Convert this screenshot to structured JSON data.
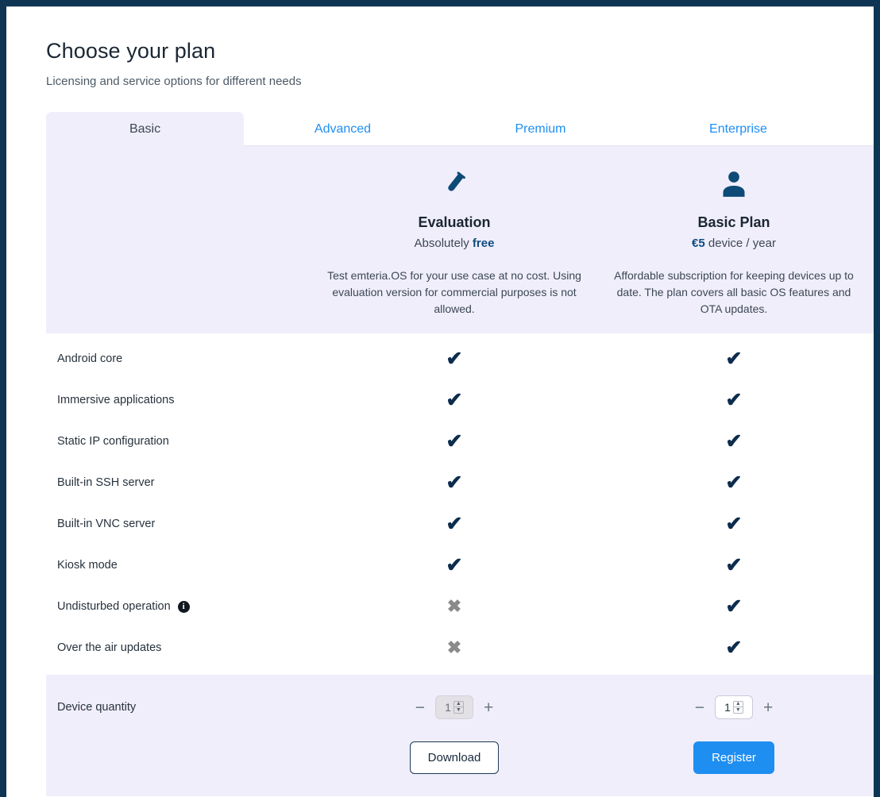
{
  "page": {
    "title": "Choose your plan",
    "subtitle": "Licensing and service options for different needs"
  },
  "colors": {
    "accent_blue": "#1f8ef1",
    "panel_lavender": "#f0eefb",
    "navy": "#0d2c4d",
    "window_border": "#0e3553",
    "mark_no_gray": "#8a8a8a"
  },
  "tabs": [
    {
      "label": "Basic",
      "active": true
    },
    {
      "label": "Advanced",
      "active": false
    },
    {
      "label": "Premium",
      "active": false
    },
    {
      "label": "Enterprise",
      "active": false
    }
  ],
  "plans": [
    {
      "icon": "test-tube-icon",
      "name": "Evaluation",
      "price_prefix": "Absolutely",
      "price_accent": "free",
      "price_suffix": "",
      "description": "Test emteria.OS for your use case at no cost. Using evaluation version for commercial purposes is not allowed."
    },
    {
      "icon": "person-icon",
      "name": "Basic Plan",
      "price_prefix": "",
      "price_accent": "€5",
      "price_suffix": "device / year",
      "description": "Affordable subscription for keeping devices up to date. The plan covers all basic OS features and OTA updates."
    }
  ],
  "features": [
    {
      "label": "Android core",
      "info": false,
      "evaluation": "yes",
      "basic": "yes"
    },
    {
      "label": "Immersive applications",
      "info": false,
      "evaluation": "yes",
      "basic": "yes"
    },
    {
      "label": "Static IP configuration",
      "info": false,
      "evaluation": "yes",
      "basic": "yes"
    },
    {
      "label": "Built-in SSH server",
      "info": false,
      "evaluation": "yes",
      "basic": "yes"
    },
    {
      "label": "Built-in VNC server",
      "info": false,
      "evaluation": "yes",
      "basic": "yes"
    },
    {
      "label": "Kiosk mode",
      "info": false,
      "evaluation": "yes",
      "basic": "yes"
    },
    {
      "label": "Undisturbed operation",
      "info": true,
      "evaluation": "no",
      "basic": "yes"
    },
    {
      "label": "Over the air updates",
      "info": false,
      "evaluation": "no",
      "basic": "yes"
    }
  ],
  "marks": {
    "yes": "✔",
    "no": "✖"
  },
  "actions": {
    "quantity_label": "Device quantity",
    "decrement_label": "−",
    "increment_label": "+",
    "evaluation": {
      "quantity": "1",
      "disabled": true,
      "button_label": "Download"
    },
    "basic": {
      "quantity": "1",
      "disabled": false,
      "button_label": "Register"
    }
  }
}
